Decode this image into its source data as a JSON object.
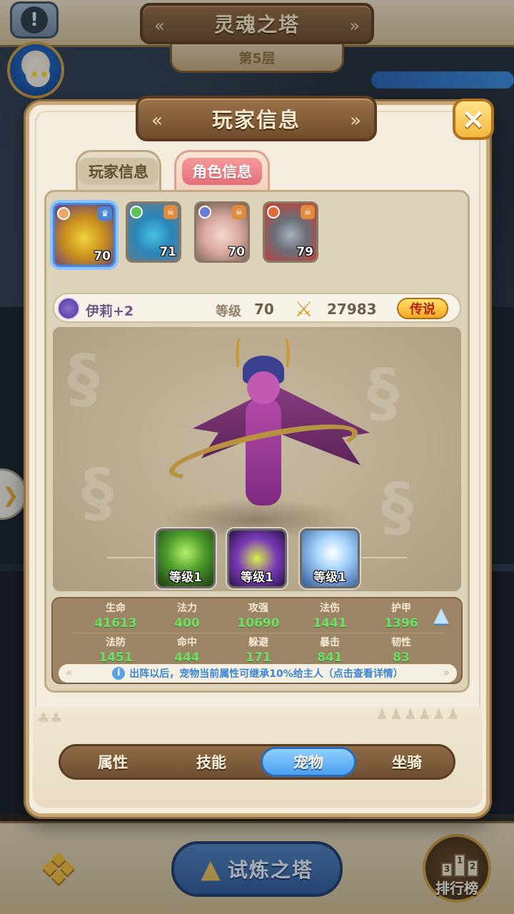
{
  "top": {
    "title": "灵魂之塔",
    "floor": "第5层"
  },
  "modal": {
    "title": "玩家信息",
    "close_label": "×",
    "tabs": [
      {
        "label": "玩家信息",
        "active": false
      },
      {
        "label": "角色信息",
        "active": true
      }
    ],
    "heroes": [
      {
        "level": "70",
        "selected": true,
        "badge": "crown"
      },
      {
        "level": "71",
        "selected": false,
        "badge": "skull"
      },
      {
        "level": "70",
        "selected": false,
        "badge": "skull"
      },
      {
        "level": "79",
        "selected": false,
        "badge": "skull"
      }
    ],
    "hero_info": {
      "name": "伊莉+2",
      "level_label": "等级",
      "level": "70",
      "power": "27983",
      "rarity": "传说"
    },
    "skills": [
      {
        "level": "等级1",
        "icon": "shadow-blade-icon"
      },
      {
        "level": "等级1",
        "icon": "purple-flame-icon"
      },
      {
        "level": "等级1",
        "icon": "ice-shard-icon"
      }
    ],
    "stats_row1": [
      {
        "label": "生命",
        "value": "41613"
      },
      {
        "label": "法力",
        "value": "400"
      },
      {
        "label": "攻强",
        "value": "10690"
      },
      {
        "label": "法伤",
        "value": "1441"
      },
      {
        "label": "护甲",
        "value": "1396"
      }
    ],
    "stats_row2": [
      {
        "label": "法防",
        "value": "1451"
      },
      {
        "label": "命中",
        "value": "444"
      },
      {
        "label": "躲避",
        "value": "171"
      },
      {
        "label": "暴击",
        "value": "841"
      },
      {
        "label": "韧性",
        "value": "83"
      }
    ],
    "note": "出阵以后，宠物当前属性可继承10%给主人（点击查看详情）",
    "bottom_tabs": [
      {
        "label": "属性",
        "active": false
      },
      {
        "label": "技能",
        "active": false
      },
      {
        "label": "宠物",
        "active": true
      },
      {
        "label": "坐骑",
        "active": false
      }
    ]
  },
  "bottom_nav": {
    "trial_label": "试炼之塔",
    "rank_label": "排行榜"
  },
  "colors": {
    "accent_blue": "#4a9ff0",
    "stat_green": "#6ee06a",
    "rarity_red": "#b4261c"
  }
}
